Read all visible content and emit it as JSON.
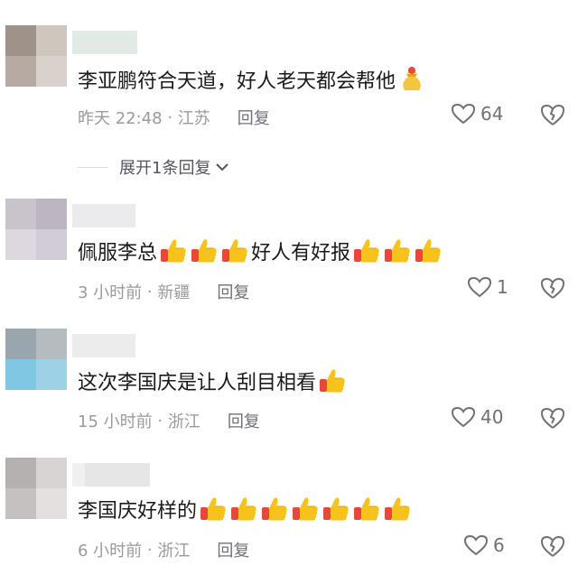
{
  "comments": [
    {
      "text": "李亚鹏符合天道，好人老天都会帮他",
      "trailing_emoji": [
        "money-bag"
      ],
      "time": "昨天 22:48",
      "location": "江苏",
      "reply_label": "回复",
      "likes": "64",
      "expand_label": "展开1条回复"
    },
    {
      "text_parts": [
        "佩服李总",
        "好人有好报"
      ],
      "time": "3 小时前",
      "location": "新疆",
      "reply_label": "回复",
      "likes": "1"
    },
    {
      "text": "这次李国庆是让人刮目相看",
      "time": "15 小时前",
      "location": "浙江",
      "reply_label": "回复",
      "likes": "40"
    },
    {
      "text": "李国庆好样的",
      "time": "6 小时前",
      "location": "浙江",
      "reply_label": "回复",
      "likes": "6"
    }
  ],
  "colors": {
    "text": "#1a1a1a",
    "meta": "#9a9aa0",
    "thumb": "#f5b800",
    "cuff": "#e8473b"
  },
  "icons": {
    "like": "heart-outline-icon",
    "dislike": "broken-heart-icon",
    "expand": "chevron-down-icon",
    "emoji_thumb": "thumbs-up-emoji",
    "emoji_money": "money-bag-emoji"
  }
}
